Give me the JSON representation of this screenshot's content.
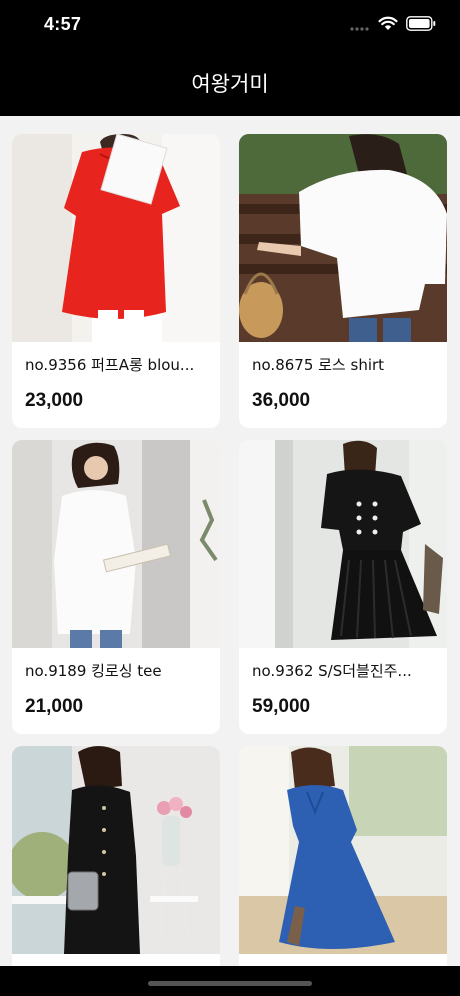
{
  "status": {
    "time": "4:57"
  },
  "nav": {
    "title": "여왕거미"
  },
  "products": [
    {
      "name": "no.9356 퍼프A롱 blou...",
      "price": "23,000",
      "photo": "model-red-blouse-photo"
    },
    {
      "name": "no.8675 로스 shirt",
      "price": "36,000",
      "photo": "model-white-shirt-photo"
    },
    {
      "name": "no.9189 킹로싱 tee",
      "price": "21,000",
      "photo": "model-white-tee-photo"
    },
    {
      "name": "no.9362  S/S더블진주...",
      "price": "59,000",
      "photo": "model-black-dress-photo"
    },
    {
      "name": "",
      "price": "",
      "photo": "model-black-shirt-dress-photo"
    },
    {
      "name": "",
      "price": "",
      "photo": "model-blue-dress-photo"
    }
  ],
  "colors": {
    "bar": "#000000",
    "background": "#f2f2f2",
    "card": "#ffffff"
  }
}
